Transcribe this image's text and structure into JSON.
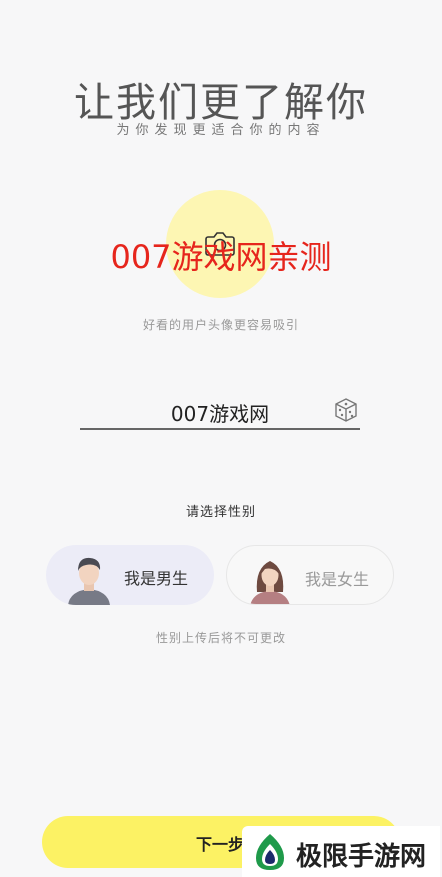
{
  "header": {
    "title": "让我们更了解你",
    "subtitle": "为你发现更适合你的内容"
  },
  "avatar": {
    "hint": "好看的用户头像更容易吸引",
    "icon": "camera-icon"
  },
  "watermark": "007游戏网亲测",
  "name_field": {
    "value": "007游戏网",
    "random_icon": "dice-icon"
  },
  "gender": {
    "title": "请选择性别",
    "male_label": "我是男生",
    "female_label": "我是女生",
    "selected": "male",
    "note": "性别上传后将不可更改"
  },
  "footer": {
    "next_label": "下一步"
  },
  "site_badge": {
    "text": "极限手游网"
  },
  "colors": {
    "accent_yellow": "#fcf264",
    "avatar_bg": "#fdf6b3",
    "watermark_red": "#e6251c"
  }
}
